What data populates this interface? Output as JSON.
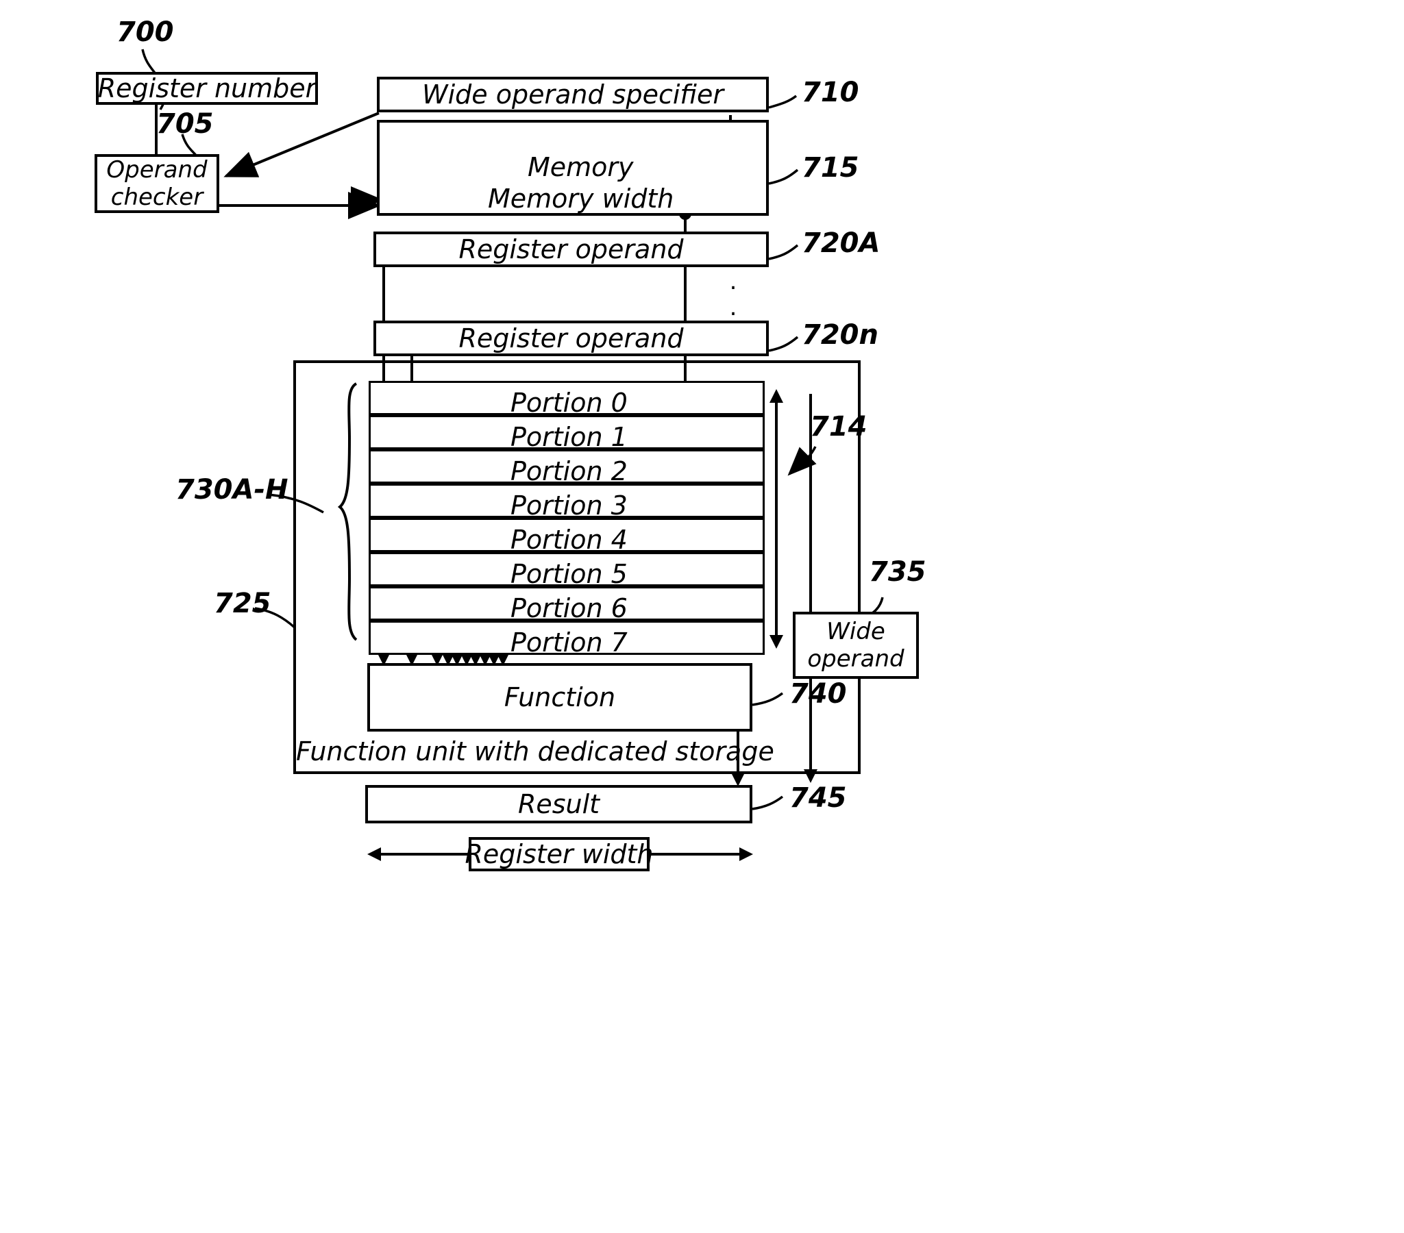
{
  "figure": {
    "title": "Wide operand function unit block diagram",
    "style": "patent-line-drawing",
    "ink_color": "#000000",
    "background_color": "#ffffff"
  },
  "blocks": {
    "register_number": "Register number",
    "operand_checker_line1": "Operand",
    "operand_checker_line2": "checker",
    "wide_operand_specifier": "Wide operand specifier",
    "memory": "Memory",
    "memory_width": "Memory width",
    "register_operand_a": "Register operand",
    "register_operand_n": "Register operand",
    "function": "Function",
    "function_unit": "Function unit with dedicated storage",
    "wide_operand_line1": "Wide",
    "wide_operand_line2": "operand",
    "result": "Result",
    "register_width": "Register width"
  },
  "portions": [
    "Portion 0",
    "Portion 1",
    "Portion 2",
    "Portion 3",
    "Portion 4",
    "Portion 5",
    "Portion 6",
    "Portion 7"
  ],
  "reference_numerals": {
    "fig_root": "700",
    "operand_checker": "705",
    "wide_operand_specifier": "710",
    "memory": "715",
    "register_operand_a": "720A",
    "register_operand_n": "720n",
    "portions_group": "730A-H",
    "function_unit": "725",
    "wide_operand_arrow": "714",
    "wide_operand": "735",
    "function": "740",
    "result": "745"
  },
  "ellipsis": {
    "vertical_dots": "."
  }
}
